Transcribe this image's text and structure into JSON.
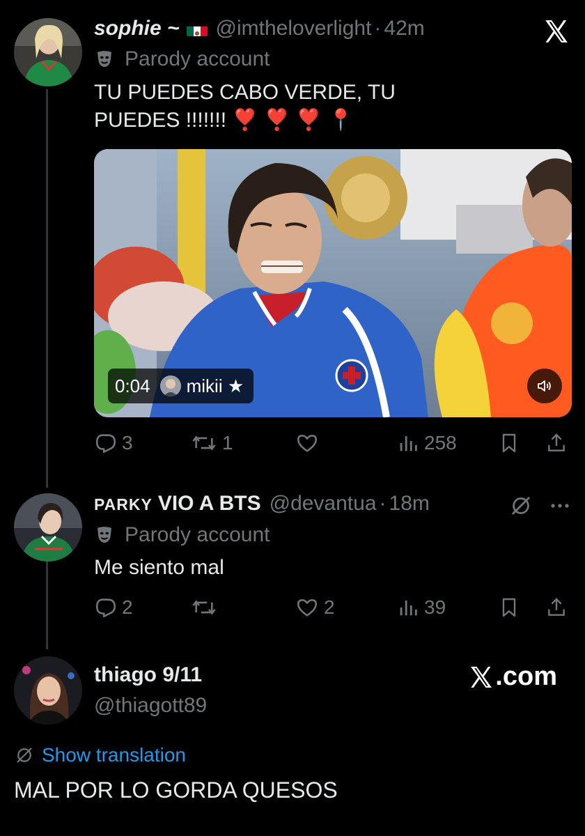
{
  "tweet1": {
    "display_name": "sophie ~",
    "flag_icon": "mexico-flag-icon",
    "handle": "@imtheloverlight",
    "separator": "·",
    "time": "42m",
    "parody_label": "Parody account",
    "text_line1": "TU PUEDES CABO VERDE, TU",
    "text_line2": "PUEDES !!!!!!! ❣️ ❣️ ❣️ 📍",
    "media": {
      "duration": "0:04",
      "source_name": "mikii ★",
      "mute_icon": "speaker-icon"
    },
    "actions": {
      "replies": "3",
      "reposts": "1",
      "likes": "",
      "views": "258"
    }
  },
  "tweet2": {
    "display_name_small": "PARKY",
    "display_name": "VIO A BTS",
    "handle": "@devantua",
    "separator": "·",
    "time": "18m",
    "parody_label": "Parody account",
    "text": "Me siento mal",
    "actions": {
      "replies": "2",
      "reposts": "",
      "likes": "2",
      "views": "39"
    }
  },
  "reply": {
    "display_name": "thiago 9/11",
    "handle": "@thiagott89",
    "site_label": ".com",
    "show_translation": "Show translation",
    "text": "MAL POR LO GORDA QUESOS"
  },
  "colors": {
    "background": "#000000",
    "text": "#e7e9ea",
    "muted": "#71767b",
    "link": "#1d9bf0"
  }
}
